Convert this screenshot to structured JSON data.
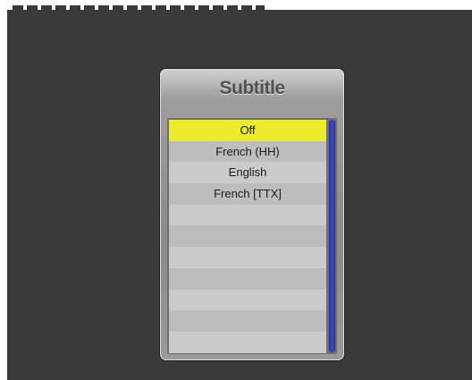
{
  "dialog": {
    "title": "Subtitle",
    "items": [
      {
        "label": "Off",
        "selected": true
      },
      {
        "label": "French (HH)",
        "selected": false
      },
      {
        "label": "English",
        "selected": false
      },
      {
        "label": "French [TTX]",
        "selected": false
      },
      {
        "label": "",
        "selected": false
      },
      {
        "label": "",
        "selected": false
      },
      {
        "label": "",
        "selected": false
      },
      {
        "label": "",
        "selected": false
      },
      {
        "label": "",
        "selected": false
      },
      {
        "label": "",
        "selected": false
      },
      {
        "label": "",
        "selected": false
      }
    ]
  },
  "colors": {
    "background": "#3a3a3a",
    "highlight": "#ecec2a",
    "scrollbar": "#3f4ad8"
  }
}
